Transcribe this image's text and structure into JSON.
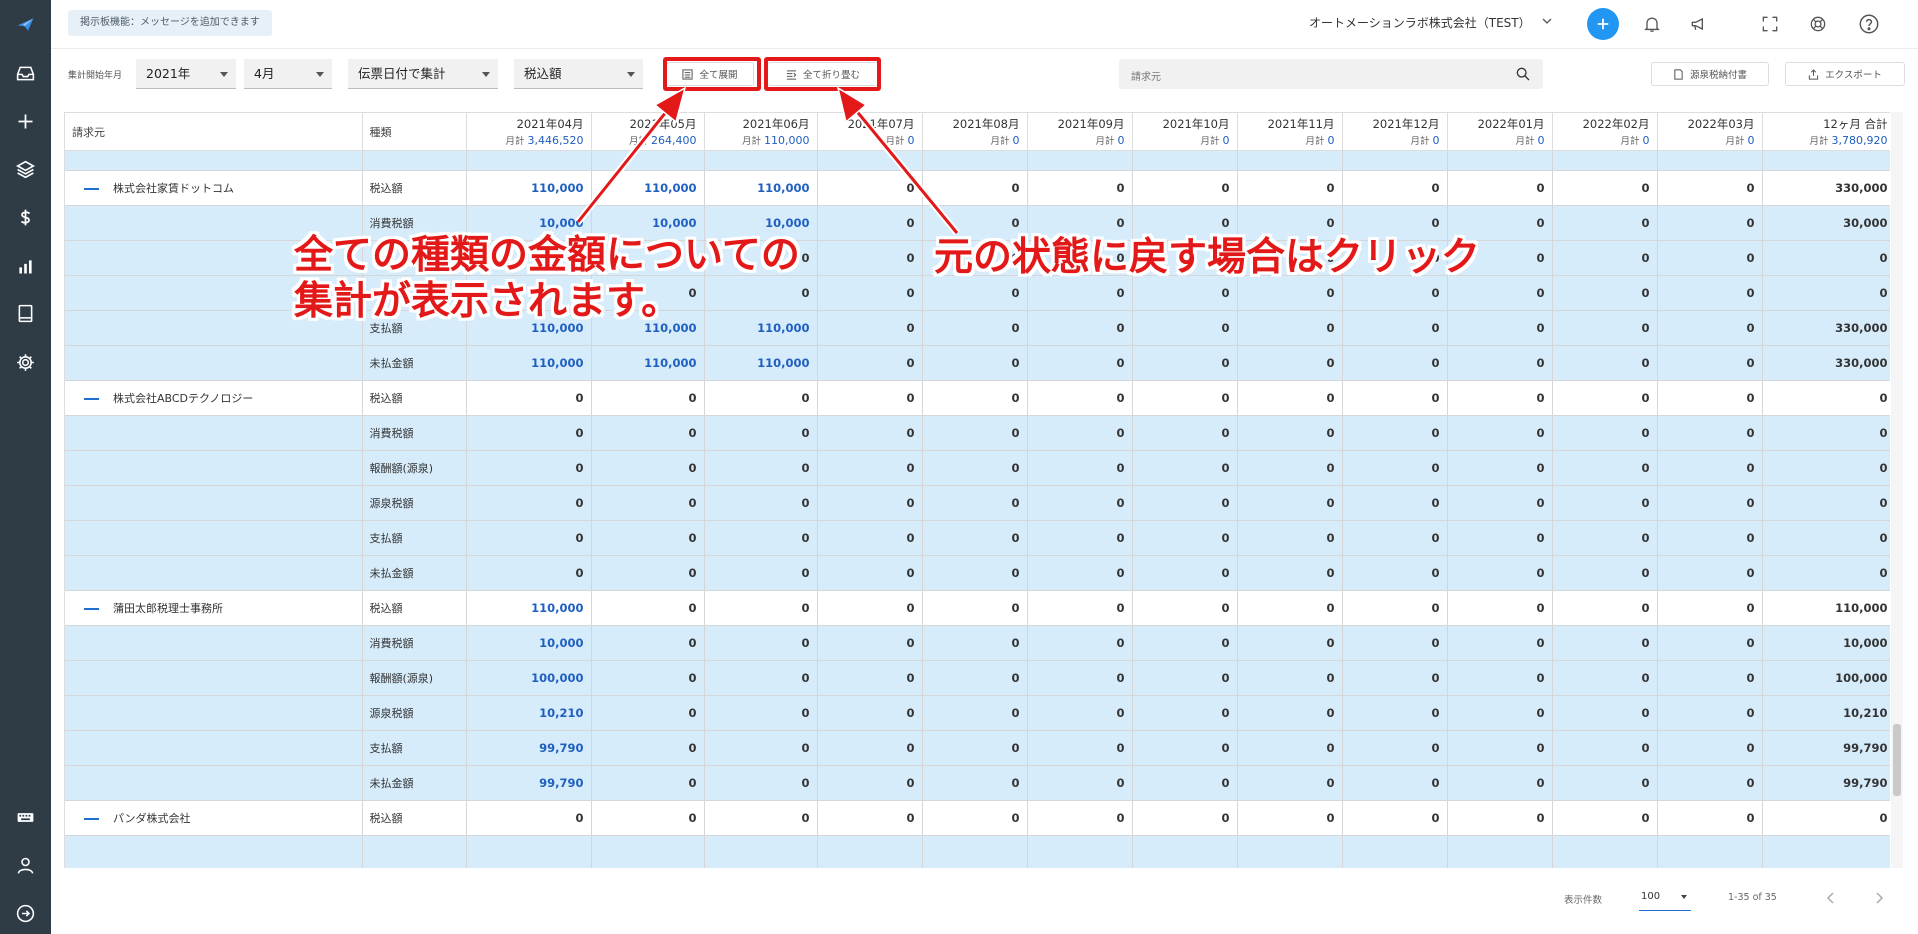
{
  "header": {
    "board_label": "掲示板機能：メッセージを追加できます",
    "company": "オートメーションラボ株式会社（TEST）"
  },
  "toolbar": {
    "start_label": "集計開始年月",
    "year": "2021年",
    "month": "4月",
    "aggregation": "伝票日付で集計",
    "amount_type": "税込額",
    "expand_all": "全て展開",
    "collapse_all": "全て折り畳む",
    "search_placeholder": "請求元",
    "withholding": "源泉税納付書",
    "export": "エクスポート"
  },
  "table": {
    "col_vendor": "請求元",
    "col_kind": "種類",
    "monthly_label": "月計",
    "months": [
      {
        "label": "2021年04月",
        "total": "3,446,520"
      },
      {
        "label": "2021年05月",
        "total": "264,400"
      },
      {
        "label": "2021年06月",
        "total": "110,000"
      },
      {
        "label": "2021年07月",
        "total": "0"
      },
      {
        "label": "2021年08月",
        "total": "0"
      },
      {
        "label": "2021年09月",
        "total": "0"
      },
      {
        "label": "2021年10月",
        "total": "0"
      },
      {
        "label": "2021年11月",
        "total": "0"
      },
      {
        "label": "2021年12月",
        "total": "0"
      },
      {
        "label": "2022年01月",
        "total": "0"
      },
      {
        "label": "2022年02月",
        "total": "0"
      },
      {
        "label": "2022年03月",
        "total": "0"
      },
      {
        "label": "12ヶ月 合計",
        "total": "3,780,920"
      }
    ],
    "rows": [
      {
        "vendor": "株式会社家賃ドットコム",
        "kind": "税込額",
        "values": [
          "110,000",
          "110,000",
          "110,000",
          "0",
          "0",
          "0",
          "0",
          "0",
          "0",
          "0",
          "0",
          "0",
          "330,000"
        ]
      },
      {
        "vendor": "",
        "kind": "消費税額",
        "values": [
          "10,000",
          "10,000",
          "10,000",
          "0",
          "0",
          "0",
          "0",
          "0",
          "0",
          "0",
          "0",
          "0",
          "30,000"
        ]
      },
      {
        "vendor": "",
        "kind": "",
        "values": [
          "",
          "0",
          "0",
          "0",
          "0",
          "0",
          "0",
          "0",
          "0",
          "0",
          "0",
          "0",
          "0"
        ]
      },
      {
        "vendor": "",
        "kind": "",
        "values": [
          "",
          "0",
          "0",
          "0",
          "0",
          "0",
          "0",
          "0",
          "0",
          "0",
          "0",
          "0",
          "0"
        ]
      },
      {
        "vendor": "",
        "kind": "支払額",
        "values": [
          "110,000",
          "110,000",
          "110,000",
          "0",
          "0",
          "0",
          "0",
          "0",
          "0",
          "0",
          "0",
          "0",
          "330,000"
        ]
      },
      {
        "vendor": "",
        "kind": "未払金額",
        "values": [
          "110,000",
          "110,000",
          "110,000",
          "0",
          "0",
          "0",
          "0",
          "0",
          "0",
          "0",
          "0",
          "0",
          "330,000"
        ]
      },
      {
        "vendor": "株式会社ABCDテクノロジー",
        "kind": "税込額",
        "values": [
          "0",
          "0",
          "0",
          "0",
          "0",
          "0",
          "0",
          "0",
          "0",
          "0",
          "0",
          "0",
          "0"
        ]
      },
      {
        "vendor": "",
        "kind": "消費税額",
        "values": [
          "0",
          "0",
          "0",
          "0",
          "0",
          "0",
          "0",
          "0",
          "0",
          "0",
          "0",
          "0",
          "0"
        ]
      },
      {
        "vendor": "",
        "kind": "報酬額(源泉)",
        "values": [
          "0",
          "0",
          "0",
          "0",
          "0",
          "0",
          "0",
          "0",
          "0",
          "0",
          "0",
          "0",
          "0"
        ]
      },
      {
        "vendor": "",
        "kind": "源泉税額",
        "values": [
          "0",
          "0",
          "0",
          "0",
          "0",
          "0",
          "0",
          "0",
          "0",
          "0",
          "0",
          "0",
          "0"
        ]
      },
      {
        "vendor": "",
        "kind": "支払額",
        "values": [
          "0",
          "0",
          "0",
          "0",
          "0",
          "0",
          "0",
          "0",
          "0",
          "0",
          "0",
          "0",
          "0"
        ]
      },
      {
        "vendor": "",
        "kind": "未払金額",
        "values": [
          "0",
          "0",
          "0",
          "0",
          "0",
          "0",
          "0",
          "0",
          "0",
          "0",
          "0",
          "0",
          "0"
        ]
      },
      {
        "vendor": "蒲田太郎税理士事務所",
        "kind": "税込額",
        "values": [
          "110,000",
          "0",
          "0",
          "0",
          "0",
          "0",
          "0",
          "0",
          "0",
          "0",
          "0",
          "0",
          "110,000"
        ]
      },
      {
        "vendor": "",
        "kind": "消費税額",
        "values": [
          "10,000",
          "0",
          "0",
          "0",
          "0",
          "0",
          "0",
          "0",
          "0",
          "0",
          "0",
          "0",
          "10,000"
        ]
      },
      {
        "vendor": "",
        "kind": "報酬額(源泉)",
        "values": [
          "100,000",
          "0",
          "0",
          "0",
          "0",
          "0",
          "0",
          "0",
          "0",
          "0",
          "0",
          "0",
          "100,000"
        ]
      },
      {
        "vendor": "",
        "kind": "源泉税額",
        "values": [
          "10,210",
          "0",
          "0",
          "0",
          "0",
          "0",
          "0",
          "0",
          "0",
          "0",
          "0",
          "0",
          "10,210"
        ]
      },
      {
        "vendor": "",
        "kind": "支払額",
        "values": [
          "99,790",
          "0",
          "0",
          "0",
          "0",
          "0",
          "0",
          "0",
          "0",
          "0",
          "0",
          "0",
          "99,790"
        ]
      },
      {
        "vendor": "",
        "kind": "未払金額",
        "values": [
          "99,790",
          "0",
          "0",
          "0",
          "0",
          "0",
          "0",
          "0",
          "0",
          "0",
          "0",
          "0",
          "99,790"
        ]
      },
      {
        "vendor": "パンダ株式会社",
        "kind": "税込額",
        "values": [
          "0",
          "0",
          "0",
          "0",
          "0",
          "0",
          "0",
          "0",
          "0",
          "0",
          "0",
          "0",
          "0"
        ]
      }
    ]
  },
  "footer": {
    "per_page_label": "表示件数",
    "per_page": "100",
    "range": "1-35 of 35"
  },
  "annotations": {
    "left_line1": "全ての種類の金額についての",
    "left_line2": "集計が表示されます。",
    "right": "元の状態に戻す場合はクリック"
  },
  "colors": {
    "sidebar": "#2f3b45",
    "accent_blue": "#2196f3",
    "link_blue": "#1f5fbf",
    "row_highlight": "#d6ecfb",
    "annotation_red": "#e31818"
  },
  "icons": [
    "logo-icon",
    "inbox-icon",
    "plus-icon",
    "layers-icon",
    "dollar-icon",
    "chart-icon",
    "book-icon",
    "gear-icon",
    "keyboard-icon",
    "user-icon",
    "logout-icon",
    "bell-icon",
    "megaphone-icon",
    "fullscreen-icon",
    "support-icon",
    "help-icon",
    "search-icon",
    "expand-icon",
    "collapse-icon",
    "document-icon",
    "export-icon"
  ]
}
